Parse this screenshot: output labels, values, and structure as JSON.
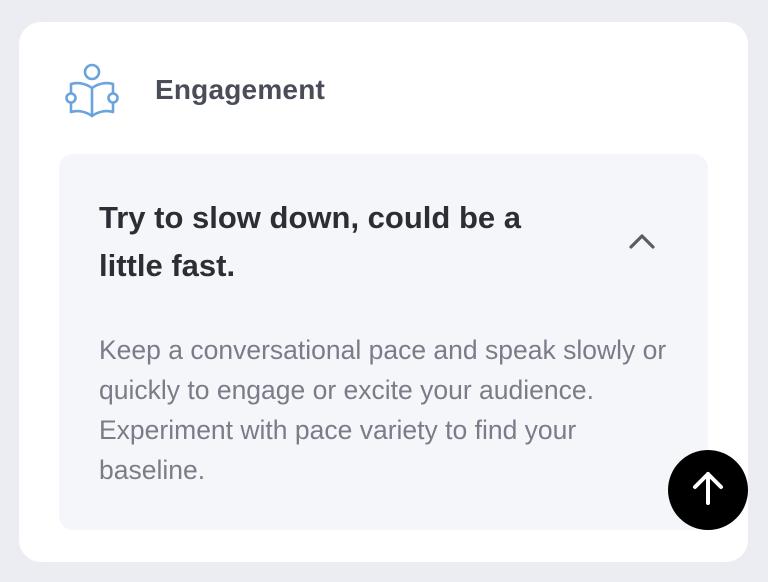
{
  "section": {
    "icon": "reader-book-icon",
    "title": "Engagement"
  },
  "tip": {
    "title": "Try to slow down, could be a little fast.",
    "toggle_icon": "chevron-up-icon",
    "body": "Keep a conversational pace and speak slowly or quickly to engage or excite your audience. Experiment with pace variety to find your baseline."
  },
  "scroll_top": {
    "icon": "arrow-up-icon"
  },
  "colors": {
    "background": "#ecedf2",
    "card": "#ffffff",
    "panel": "#f5f6f9",
    "icon_accent": "#6aa3dd",
    "fab": "#000000"
  }
}
